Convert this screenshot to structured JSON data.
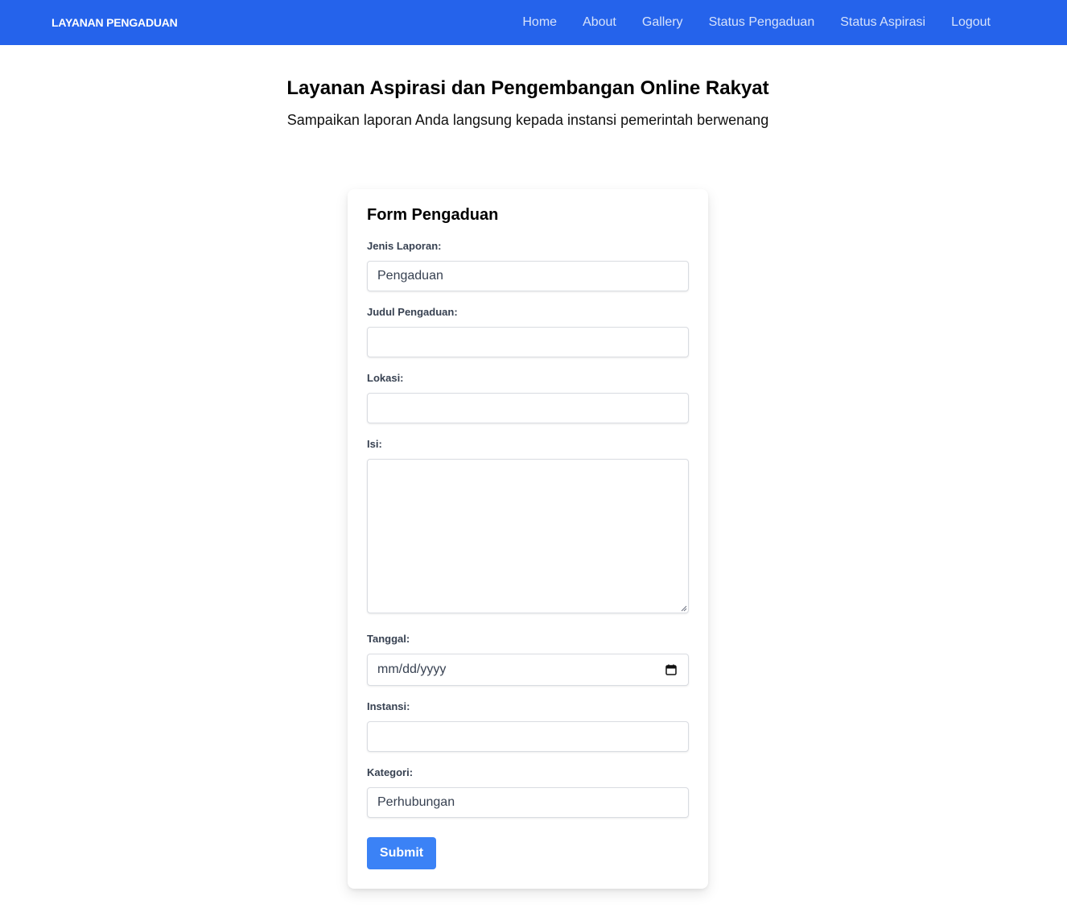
{
  "navbar": {
    "brand": "LAYANAN PENGADUAN",
    "links": [
      {
        "label": "Home"
      },
      {
        "label": "About"
      },
      {
        "label": "Gallery"
      },
      {
        "label": "Status Pengaduan"
      },
      {
        "label": "Status Aspirasi"
      },
      {
        "label": "Logout"
      }
    ],
    "background_color": "#2563eb"
  },
  "hero": {
    "title": "Layanan Aspirasi dan Pengembangan Online Rakyat",
    "subtitle": "Sampaikan laporan Anda langsung kepada instansi pemerintah berwenang"
  },
  "form": {
    "title": "Form Pengaduan",
    "jenis_laporan": {
      "label": "Jenis Laporan:",
      "value": "Pengaduan"
    },
    "judul": {
      "label": "Judul Pengaduan:",
      "value": ""
    },
    "lokasi": {
      "label": "Lokasi:",
      "value": ""
    },
    "isi": {
      "label": "Isi:",
      "value": ""
    },
    "tanggal": {
      "label": "Tanggal:",
      "placeholder": "mm/dd/yyyy",
      "icon": "calendar-icon"
    },
    "instansi": {
      "label": "Instansi:",
      "value": ""
    },
    "kategori": {
      "label": "Kategori:",
      "value": "Perhubungan"
    },
    "submit_label": "Submit",
    "submit_color": "#3b82f6"
  }
}
